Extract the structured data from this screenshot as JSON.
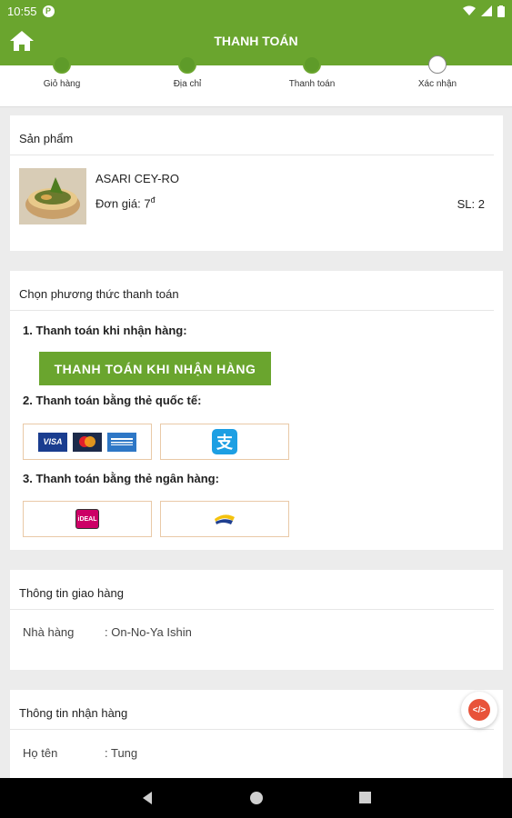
{
  "status": {
    "time": "10:55"
  },
  "appbar": {
    "title": "THANH TOÁN",
    "home_icon": "home-icon"
  },
  "stepper": {
    "steps": [
      {
        "label": "Giỏ hàng",
        "done": true
      },
      {
        "label": "Địa chỉ",
        "done": true
      },
      {
        "label": "Thanh toán",
        "done": true
      },
      {
        "label": "Xác nhận",
        "done": false
      }
    ]
  },
  "product": {
    "section_title": "Sản phẩm",
    "name": "ASARI CEY-RO",
    "price_label": "Đơn giá: 7",
    "currency": "đ",
    "qty": "SL: 2"
  },
  "payment": {
    "section_title": "Chọn phương thức thanh toán",
    "option1": "1. Thanh toán khi nhận hàng:",
    "cod_button": "THANH TOÁN KHI NHẬN HÀNG",
    "option2": "2. Thanh toán bằng thẻ quốc tế:",
    "option3": "3. Thanh toán bằng thẻ ngân hàng:",
    "logos": {
      "visa": "VISA",
      "ideal": "iDEAL"
    }
  },
  "delivery": {
    "section_title": "Thông tin giao hàng",
    "restaurant_label": "Nhà hàng",
    "restaurant_value": ": On-No-Ya Ishin"
  },
  "receiver": {
    "section_title": "Thông tin nhận hàng",
    "name_label": "Họ tên",
    "name_value": ": Tung"
  },
  "colors": {
    "primary": "#6aa52e",
    "fab": "#e8533a"
  }
}
